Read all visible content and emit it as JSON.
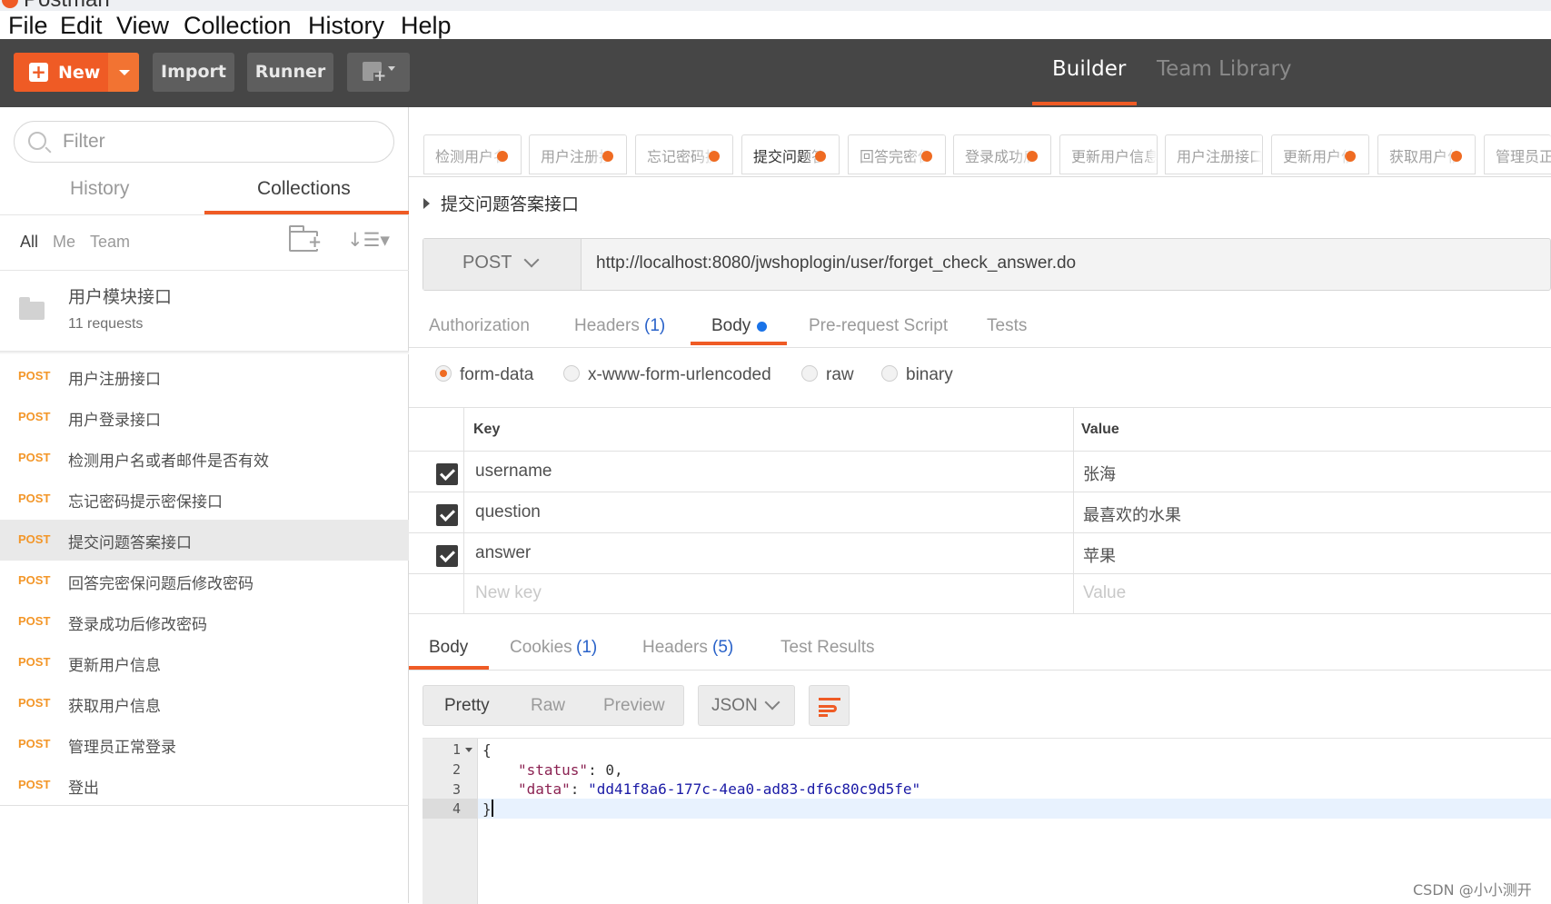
{
  "window": {
    "title": "Postman"
  },
  "menu": [
    "File",
    "Edit",
    "View",
    "Collection",
    "History",
    "Help"
  ],
  "header": {
    "new_label": "New",
    "import_label": "Import",
    "runner_label": "Runner",
    "tabs": [
      "Builder",
      "Team Library"
    ]
  },
  "sidebar": {
    "filter_placeholder": "Filter",
    "tabs": [
      "History",
      "Collections"
    ],
    "filters": [
      "All",
      "Me",
      "Team"
    ],
    "collection": {
      "name": "用户模块接口",
      "count": "11 requests"
    },
    "requests": [
      {
        "method": "POST",
        "name": "用户注册接口"
      },
      {
        "method": "POST",
        "name": "用户登录接口"
      },
      {
        "method": "POST",
        "name": "检测用户名或者邮件是否有效"
      },
      {
        "method": "POST",
        "name": "忘记密码提示密保接口"
      },
      {
        "method": "POST",
        "name": "提交问题答案接口"
      },
      {
        "method": "POST",
        "name": "回答完密保问题后修改密码"
      },
      {
        "method": "POST",
        "name": "登录成功后修改密码"
      },
      {
        "method": "POST",
        "name": "更新用户信息"
      },
      {
        "method": "POST",
        "name": "获取用户信息"
      },
      {
        "method": "POST",
        "name": "管理员正常登录"
      },
      {
        "method": "POST",
        "name": "登出"
      }
    ]
  },
  "request_tabs": [
    "检测用户名或者邮件是否有效",
    "用户注册接口",
    "忘记密码提示密保接口",
    "提交问题答案接口",
    "回答完密保问题后修改密码",
    "登录成功后修改密码",
    "更新用户信息",
    "用户注册接口",
    "更新用户信息",
    "获取用户信息",
    "管理员正常登录"
  ],
  "request": {
    "title": "提交问题答案接口",
    "method": "POST",
    "url": "http://localhost:8080/jwshoplogin/user/forget_check_answer.do",
    "tabs": {
      "authorization": "Authorization",
      "headers": "Headers",
      "headers_count": "(1)",
      "body": "Body",
      "prerequest": "Pre-request Script",
      "tests": "Tests"
    },
    "body_modes": [
      "form-data",
      "x-www-form-urlencoded",
      "raw",
      "binary"
    ],
    "table_headers": {
      "key": "Key",
      "value": "Value"
    },
    "params": [
      {
        "key": "username",
        "value": "张海"
      },
      {
        "key": "question",
        "value": "最喜欢的水果"
      },
      {
        "key": "answer",
        "value": "苹果"
      }
    ],
    "new_key_placeholder": "New key",
    "new_value_placeholder": "Value"
  },
  "response": {
    "tabs": {
      "body": "Body",
      "cookies": "Cookies",
      "cookies_count": "(1)",
      "headers": "Headers",
      "headers_count": "(5)",
      "tests": "Test Results"
    },
    "views": [
      "Pretty",
      "Raw",
      "Preview"
    ],
    "format": "JSON",
    "lines": [
      {
        "no": "1",
        "text": "{"
      },
      {
        "no": "2",
        "key": "\"status\"",
        "sep": ": ",
        "val": "0",
        "end": ","
      },
      {
        "no": "3",
        "key": "\"data\"",
        "sep": ": ",
        "val": "\"dd41f8a6-177c-4ea0-ad83-df6c80c9d5fe\"",
        "end": ""
      },
      {
        "no": "4",
        "text": "}"
      }
    ]
  },
  "watermark": "CSDN @小小测开",
  "colors": {
    "accent": "#ef5b25",
    "method_post": "#f39628",
    "header_bg": "#464646",
    "count_blue": "#2962c9"
  }
}
